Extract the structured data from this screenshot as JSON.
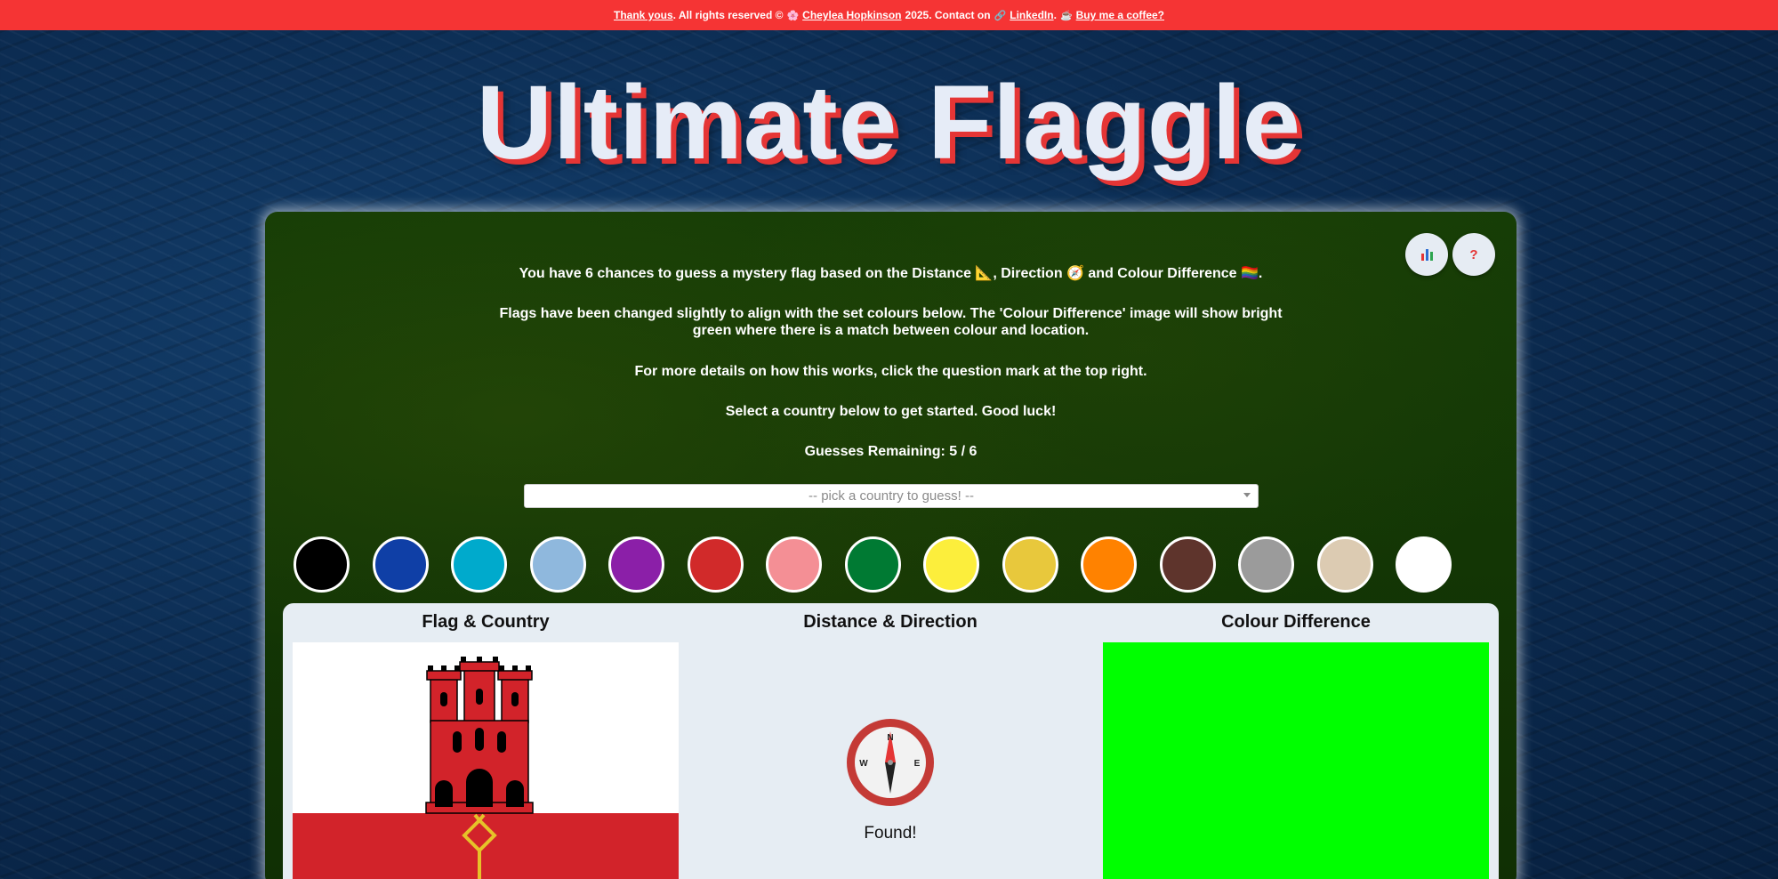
{
  "footer": {
    "thanks_link": "Thank yous",
    "rights_text": ". All rights reserved ©",
    "author_link": "Cheylea Hopkinson",
    "year_text": "2025. Contact on",
    "linkedin_link": "LinkedIn",
    "dot_text": ".",
    "coffee_link": "Buy me a coffee?"
  },
  "title": "Ultimate Flaggle",
  "instructions": {
    "line1": "You have 6 chances to guess a mystery flag based on the Distance 📐, Direction 🧭 and Colour Difference 🏳️‍🌈.",
    "line2": "Flags have been changed slightly to align with the set colours below. The 'Colour Difference' image will show bright green where there is a match between colour and location.",
    "line3": "For more details on how this works, click the question mark at the top right.",
    "line4": "Select a country below to get started. Good luck!",
    "guesses": "Guesses Remaining: 5 / 6"
  },
  "country_select": {
    "placeholder": "-- pick a country to guess! --"
  },
  "buttons": {
    "stats_icon": "bar-chart-icon",
    "help_label": "?"
  },
  "palette": [
    "#000000",
    "#0f3fa6",
    "#00aacc",
    "#8fb8dd",
    "#8b1fa8",
    "#d12a2a",
    "#f48f95",
    "#007a33",
    "#fcee3c",
    "#e8c83c",
    "#ff8200",
    "#5e342c",
    "#9b9b9b",
    "#dccbb2",
    "#ffffff"
  ],
  "results": {
    "col_flag": "Flag & Country",
    "col_distance": "Distance & Direction",
    "col_colour": "Colour Difference",
    "compass_n": "N",
    "compass_w": "W",
    "compass_e": "E",
    "status": "Found!",
    "match_color": "#00ff00"
  }
}
